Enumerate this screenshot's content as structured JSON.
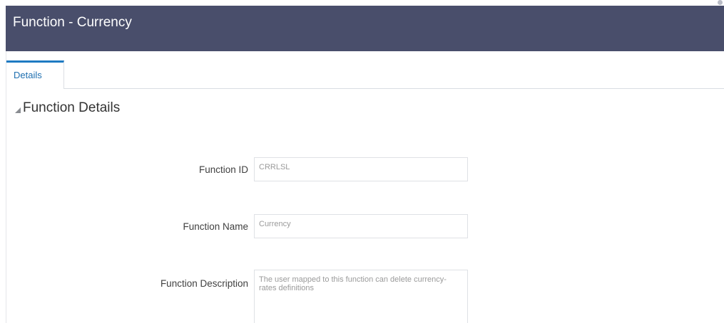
{
  "header": {
    "title": "Function - Currency"
  },
  "tabs": [
    {
      "label": "Details",
      "active": true
    }
  ],
  "section": {
    "title": "Function Details"
  },
  "form": {
    "function_id": {
      "label": "Function ID",
      "value": "CRRLSL"
    },
    "function_name": {
      "label": "Function Name",
      "value": "Currency"
    },
    "function_description": {
      "label": "Function Description",
      "value": "The user mapped to this function can delete currency-rates definitions"
    }
  },
  "colors": {
    "header_bg": "#494e6b",
    "tab_accent": "#1e7ac2"
  }
}
